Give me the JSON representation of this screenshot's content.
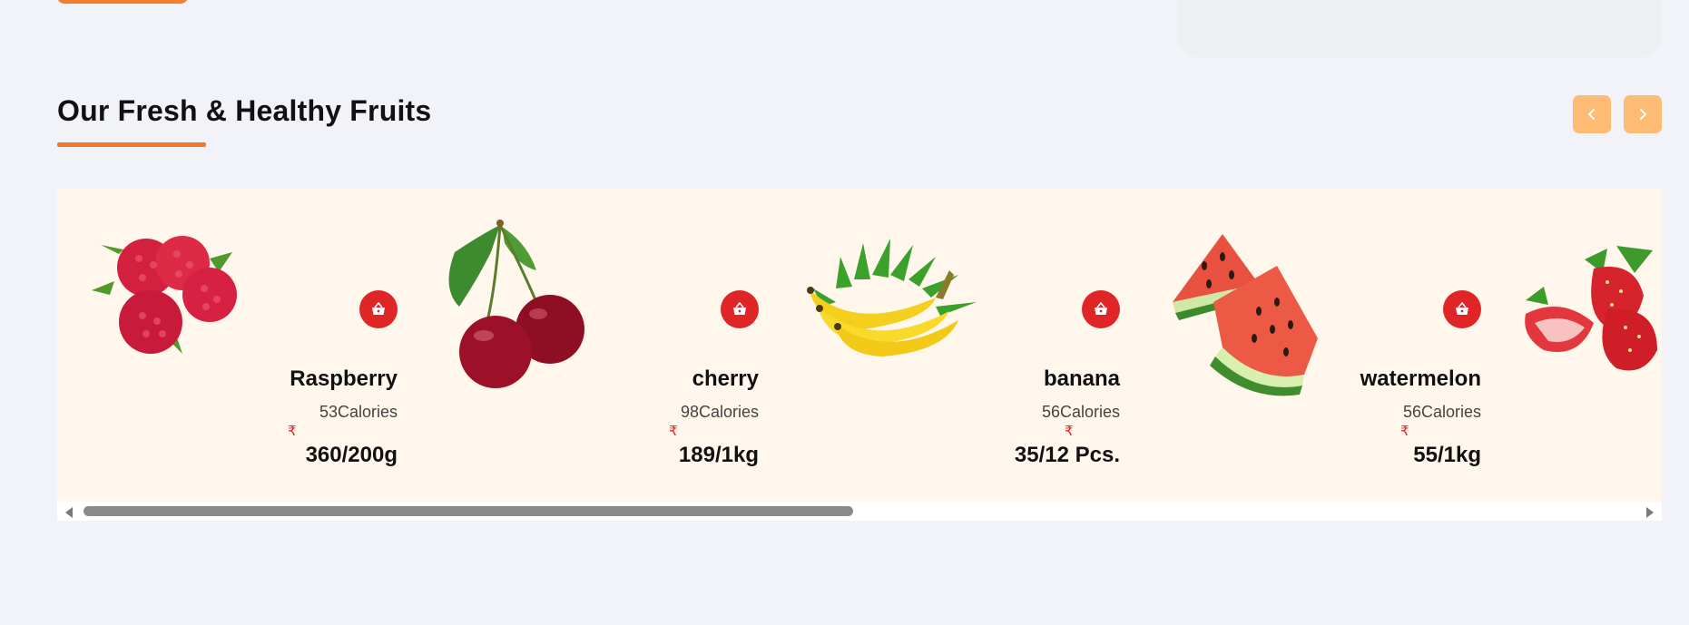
{
  "section": {
    "title": "Our Fresh & Healthy Fruits"
  },
  "nav": {
    "prev_icon": "chevron-left-icon",
    "next_icon": "chevron-right-icon"
  },
  "colors": {
    "accent": "#f07a2a",
    "nav_button": "#fdbb73",
    "cart_button": "#e02527",
    "card_background": "#fff6ec",
    "page_background": "#f1f3f8"
  },
  "currency_symbol": "₹",
  "fruits": [
    {
      "name": "Raspberry",
      "calories": "53Calories",
      "price": "360/200g",
      "image": "raspberry-image"
    },
    {
      "name": "cherry",
      "calories": "98Calories",
      "price": "189/1kg",
      "image": "cherry-image"
    },
    {
      "name": "banana",
      "calories": "56Calories",
      "price": "35/12 Pcs.",
      "image": "banana-image"
    },
    {
      "name": "watermelon",
      "calories": "56Calories",
      "price": "55/1kg",
      "image": "watermelon-image"
    },
    {
      "name": "",
      "calories": "",
      "price": "",
      "image": "strawberry-image"
    }
  ],
  "scrollbar": {
    "visible_fraction": 0.49
  }
}
